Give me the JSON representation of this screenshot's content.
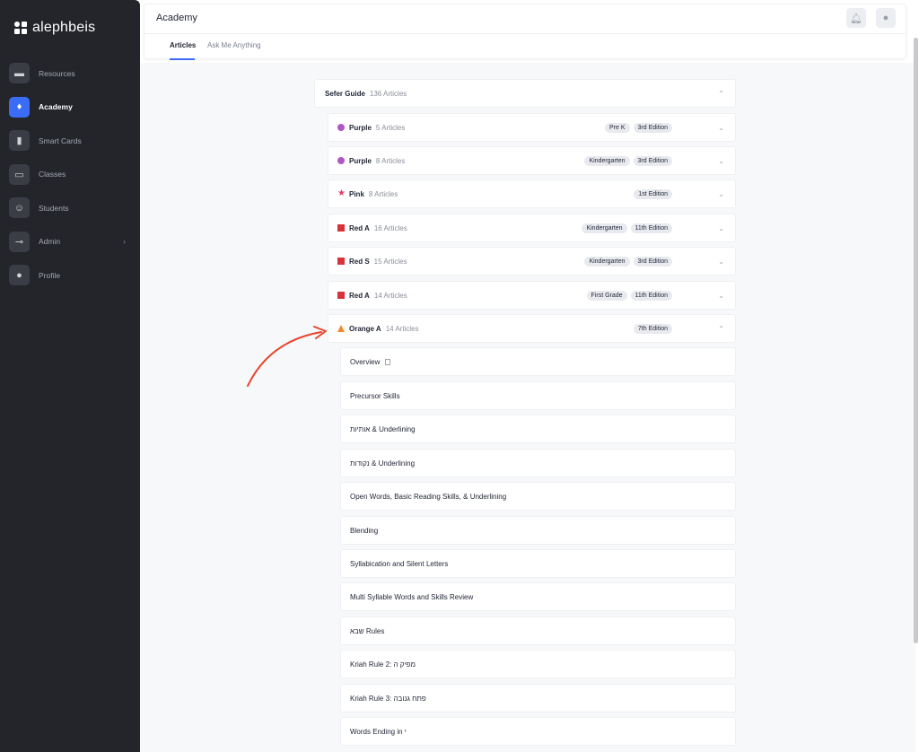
{
  "app": {
    "logo_text": "alephbeis"
  },
  "sidebar": {
    "items": [
      {
        "label": "Resources",
        "icon": "folder-icon"
      },
      {
        "label": "Academy",
        "icon": "lightbulb-icon",
        "active": true
      },
      {
        "label": "Smart Cards",
        "icon": "cards-icon"
      },
      {
        "label": "Classes",
        "icon": "keyboard-icon"
      },
      {
        "label": "Students",
        "icon": "smiley-icon"
      },
      {
        "label": "Admin",
        "icon": "key-icon"
      },
      {
        "label": "Profile",
        "icon": "user-icon"
      }
    ]
  },
  "header": {
    "title": "Academy",
    "tabs": [
      {
        "label": "Articles",
        "active": true
      },
      {
        "label": "Ask Me Anything"
      }
    ]
  },
  "guide": {
    "title": "Sefer Guide",
    "count": "136 Articles"
  },
  "rows": [
    {
      "title": "Purple",
      "count": "5 Articles",
      "shape": "circle",
      "color": "#b056c9",
      "badges": [
        "Pre K",
        "3rd Edition"
      ]
    },
    {
      "title": "Purple",
      "count": "8 Articles",
      "shape": "circle",
      "color": "#b056c9",
      "badges": [
        "Kindergarten",
        "3rd Edition"
      ]
    },
    {
      "title": "Pink",
      "count": "8 Articles",
      "shape": "star",
      "color": "#e23b6a",
      "badges": [
        "1st Edition"
      ]
    },
    {
      "title": "Red A",
      "count": "16 Articles",
      "shape": "square",
      "color": "#d8323b",
      "badges": [
        "Kindergarten",
        "11th Edition"
      ]
    },
    {
      "title": "Red S",
      "count": "15 Articles",
      "shape": "square",
      "color": "#d8323b",
      "badges": [
        "Kindergarten",
        "3rd Edition"
      ]
    },
    {
      "title": "Red A",
      "count": "14 Articles",
      "shape": "square",
      "color": "#d8323b",
      "badges": [
        "First Grade",
        "11th Edition"
      ]
    },
    {
      "title": "Orange A",
      "count": "14 Articles",
      "shape": "triangle",
      "color": "#f08a2b",
      "badges": [
        "7th Edition"
      ],
      "expanded": true
    }
  ],
  "articles": [
    "Overview",
    "Precursor Skills",
    "אותיות & Underlining",
    "נקודות & Underlining",
    "Open Words, Basic Reading Skills, & Underlining",
    "Blending",
    "Syllabication and Silent Letters",
    "Multi Syllable Words and Skills Review",
    "שבא Rules",
    "Kriah Rule 2: מפיק ה",
    "Kriah Rule 3: פתח גנובה",
    "Words Ending in י"
  ],
  "colors": {
    "accent": "#3b6cf6",
    "annotation_arrow": "#e8452c"
  }
}
